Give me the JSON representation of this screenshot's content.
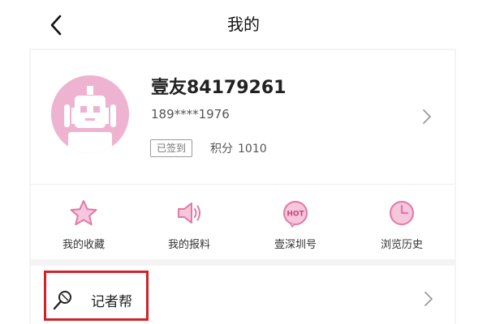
{
  "header": {
    "title": "我的",
    "back_icon": "back-arrow-icon"
  },
  "profile": {
    "username": "壹友84179261",
    "phone": "189****1976",
    "signed_badge": "已签到",
    "points_label": "积分",
    "points_value": "1010",
    "avatar_icon": "robot-avatar-icon",
    "chevron_icon": "chevron-right-icon"
  },
  "shortcuts": [
    {
      "label": "我的收藏",
      "icon": "star-icon"
    },
    {
      "label": "我的报料",
      "icon": "speaker-icon"
    },
    {
      "label": "壹深圳号",
      "icon": "hot-badge-icon"
    },
    {
      "label": "浏览历史",
      "icon": "clock-icon"
    }
  ],
  "menu": {
    "items": [
      {
        "label": "记者帮",
        "icon": "microphone-icon",
        "chevron_icon": "chevron-right-icon"
      }
    ]
  },
  "highlight": {
    "target": "记者帮",
    "color": "#d0222a"
  },
  "colors": {
    "accent_pink": "#e07aa8",
    "icon_fill_pink": "#f5c6dc",
    "avatar_bg": "#eeb3d0"
  }
}
